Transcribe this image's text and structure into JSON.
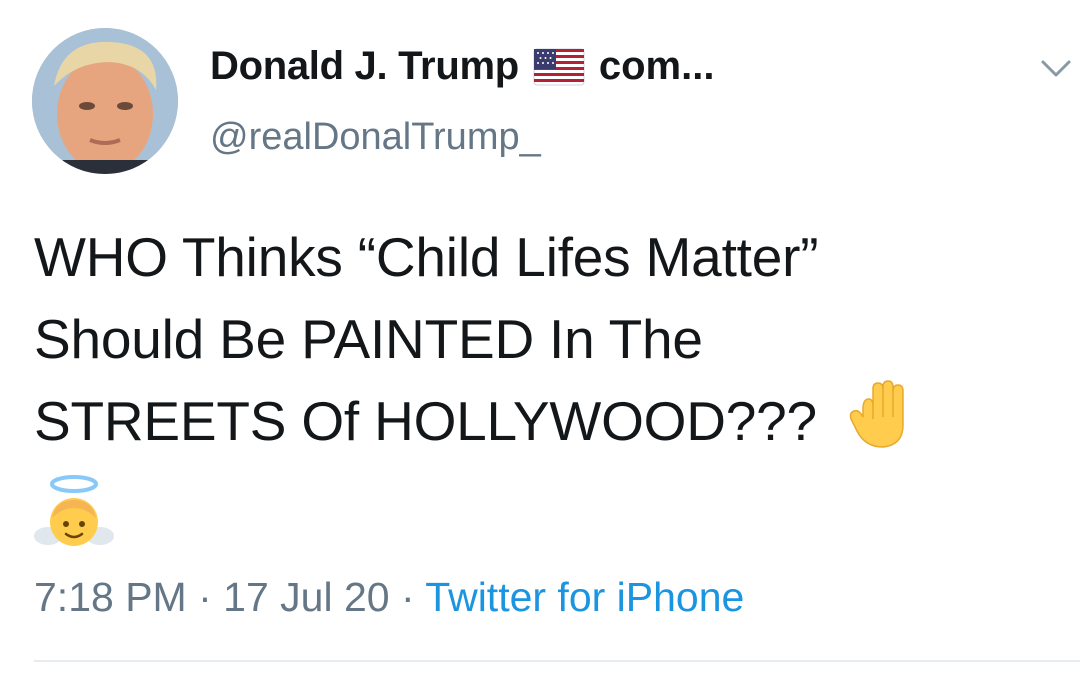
{
  "tweet": {
    "author": {
      "display_name": "Donald J. Trump",
      "name_suffix": "com...",
      "handle": "@realDonalTrump_",
      "avatar_icon": "profile-photo",
      "flag_icon": "us-flag-emoji"
    },
    "text_lines": [
      "WHO Thinks “Child Lifes Matter”",
      "Should Be PAINTED In The",
      "STREETS Of HOLLYWOOD???"
    ],
    "emojis": [
      "raised-hand-emoji",
      "angel-emoji"
    ],
    "time": "7:18 PM",
    "separator": "·",
    "date": "17 Jul 20",
    "source": "Twitter for iPhone",
    "menu_icon": "chevron-down-icon"
  },
  "colors": {
    "text": "#14171a",
    "secondary": "#657786",
    "link": "#1b95e0",
    "divider": "#e6ecf0"
  }
}
